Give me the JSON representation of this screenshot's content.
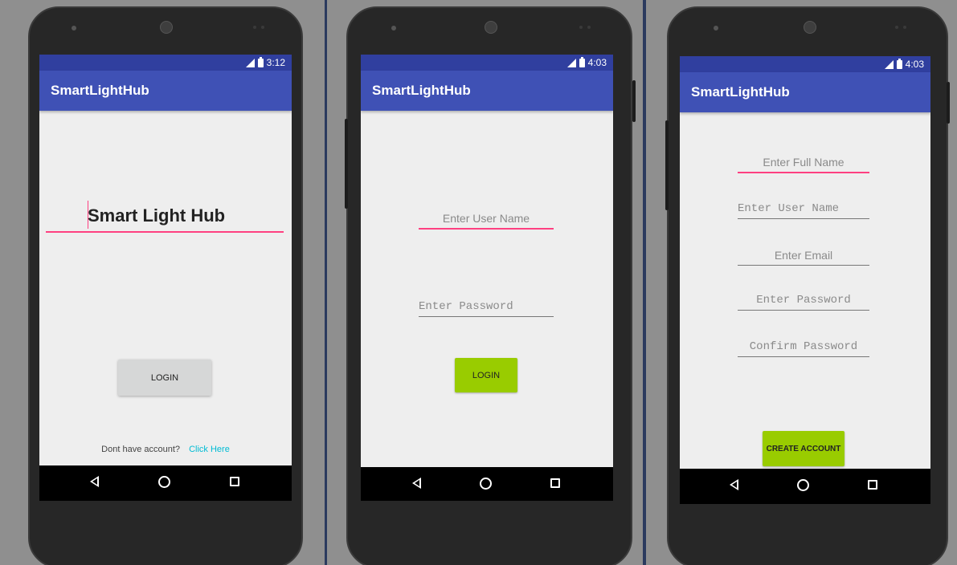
{
  "app": {
    "title": "SmartLightHub"
  },
  "screens": [
    {
      "status": {
        "time": "3:12"
      },
      "title_field": "Smart Light Hub",
      "login_button": "LOGIN",
      "footer": {
        "prompt": "Dont have account?",
        "link": "Click Here"
      }
    },
    {
      "status": {
        "time": "4:03"
      },
      "username_placeholder": "Enter User Name",
      "password_placeholder": "Enter Password",
      "login_button": "LOGIN"
    },
    {
      "status": {
        "time": "4:03"
      },
      "fullname_placeholder": "Enter Full Name",
      "username_placeholder": "Enter User Name",
      "email_placeholder": "Enter Email",
      "password_placeholder": "Enter Password",
      "confirm_placeholder": "Confirm Password",
      "create_button": "CREATE ACCOUNT"
    }
  ],
  "icons": [
    "signal-icon",
    "battery-icon",
    "back-icon",
    "home-icon",
    "recents-icon"
  ],
  "colors": {
    "status_bar": "#303f9f",
    "app_bar": "#3f51b5",
    "accent": "#ff4081",
    "green_button": "#99cc00",
    "link": "#00bcd4"
  }
}
